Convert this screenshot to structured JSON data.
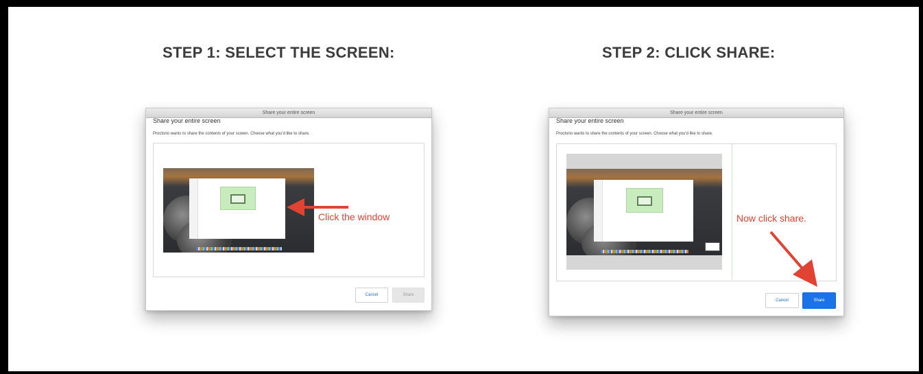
{
  "steps": [
    {
      "title": "STEP 1: SELECT THE SCREEN:",
      "dialog": {
        "titlebar": "Share your entire screen",
        "heading": "Share your entire screen",
        "subtitle": "Proctorio wants to share the contents of your screen. Choose what you'd like to share.",
        "cancel_label": "Cancel",
        "share_label": "Share",
        "share_enabled": false
      },
      "annotation": "Click the window"
    },
    {
      "title": "STEP 2: CLICK SHARE:",
      "dialog": {
        "titlebar": "Share your entire screen",
        "heading": "Share your entire screen",
        "subtitle": "Proctorio wants to share the contents of your screen. Choose what you'd like to share.",
        "cancel_label": "Cancel",
        "share_label": "Share",
        "share_enabled": true
      },
      "annotation": "Now click share."
    }
  ],
  "colors": {
    "annotation": "#e04332",
    "share_active": "#1a73e8",
    "title": "#3b3b3b"
  }
}
